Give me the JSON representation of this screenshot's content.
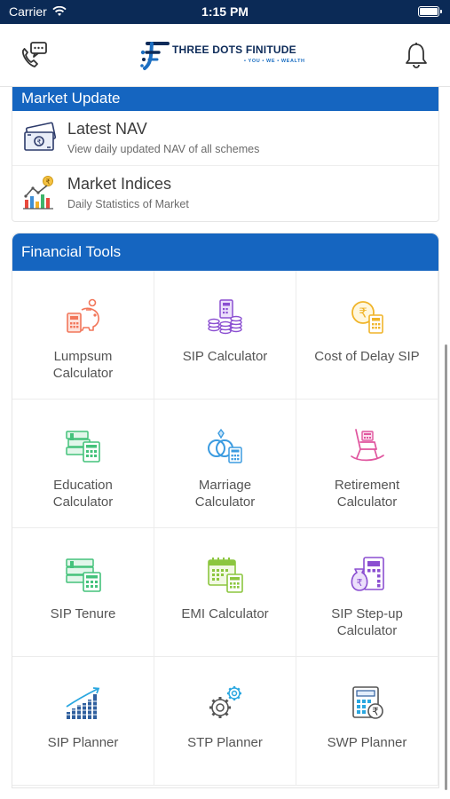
{
  "status_bar": {
    "carrier": "Carrier",
    "time": "1:15 PM"
  },
  "header": {
    "brand_name": "THREE DOTS FINITUDE",
    "tagline": "• YOU • WE • WEALTH",
    "left_icon": "phone-chat-icon",
    "right_icon": "bell-icon"
  },
  "market_update": {
    "title": "Market Update",
    "items": [
      {
        "title": "Latest NAV",
        "subtitle": "View daily updated NAV of all schemes",
        "icon": "cash-icon"
      },
      {
        "title": "Market Indices",
        "subtitle": "Daily Statistics of Market",
        "icon": "bar-chart-rupee-icon"
      }
    ]
  },
  "financial_tools": {
    "title": "Financial Tools",
    "items": [
      {
        "label": "Lumpsum\nCalculator",
        "icon": "piggy-bank-calculator-icon",
        "color": "#f2765a"
      },
      {
        "label": "SIP Calculator",
        "icon": "coin-stack-calculator-icon",
        "color": "#8b4fd1"
      },
      {
        "label": "Cost of Delay SIP",
        "icon": "rupee-coin-calculator-icon",
        "color": "#f0b429"
      },
      {
        "label": "Education\nCalculator",
        "icon": "books-calculator-icon",
        "color": "#44c27b"
      },
      {
        "label": "Marriage\nCalculator",
        "icon": "rings-calculator-icon",
        "color": "#3b9be0"
      },
      {
        "label": "Retirement\nCalculator",
        "icon": "rocking-chair-icon",
        "color": "#e0569f"
      },
      {
        "label": "SIP Tenure",
        "icon": "books-calculator-icon",
        "color": "#44c27b"
      },
      {
        "label": "EMI Calculator",
        "icon": "calendar-calculator-icon",
        "color": "#8cc63f"
      },
      {
        "label": "SIP Step-up\nCalculator",
        "icon": "money-bag-calculator-icon",
        "color": "#8b4fd1"
      },
      {
        "label": "SIP Planner",
        "icon": "growth-bars-icon",
        "color": "#2f5f9e"
      },
      {
        "label": "STP Planner",
        "icon": "gears-icon",
        "color": "#2aa7e0"
      },
      {
        "label": "SWP Planner",
        "icon": "calculator-rupee-icon",
        "color": "#2f5f9e"
      }
    ]
  }
}
